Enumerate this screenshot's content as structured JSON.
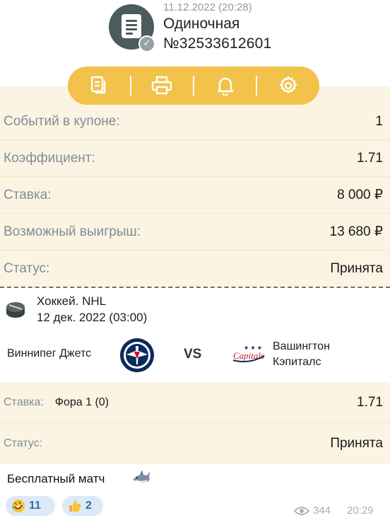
{
  "header": {
    "date": "11.12.2022 (20:28)",
    "bet_type": "Одиночная",
    "coupon_number": "№32533612601",
    "icon": "receipt-icon",
    "badge_icon": "check-icon"
  },
  "toolbar": {
    "buttons": [
      "copy-icon",
      "print-icon",
      "bell-icon",
      "gear-icon"
    ],
    "accent_color": "#f2c24a"
  },
  "summary": {
    "rows": [
      {
        "label": "Событий в купоне:",
        "value": "1"
      },
      {
        "label": "Коэффициент:",
        "value": "1.71"
      },
      {
        "label": "Ставка:",
        "value": "8 000 ₽"
      },
      {
        "label": "Возможный выигрыш:",
        "value": "13 680 ₽"
      },
      {
        "label": "Статус:",
        "value": "Принята"
      }
    ]
  },
  "event": {
    "league": "Хоккей. NHL",
    "datetime": "12 дек. 2022 (03:00)",
    "team_home": "Виннипег Джетс",
    "vs": "VS",
    "team_away_line1": "Вашингтон",
    "team_away_line2": "Кэпиталс",
    "logo_text": "Capitals"
  },
  "bet": {
    "stake_label": "Ставка:",
    "stake_market": "Фора 1 (0)",
    "stake_odds": "1.71",
    "status_label": "Статус:",
    "status_value": "Принята"
  },
  "message": {
    "text": "Бесплатный матч",
    "reactions": [
      {
        "icon": "rofl-emoji-icon",
        "count": "11"
      },
      {
        "icon": "thumbs-up-emoji-icon",
        "count": "2"
      }
    ],
    "views": "344",
    "time": "20:29"
  }
}
